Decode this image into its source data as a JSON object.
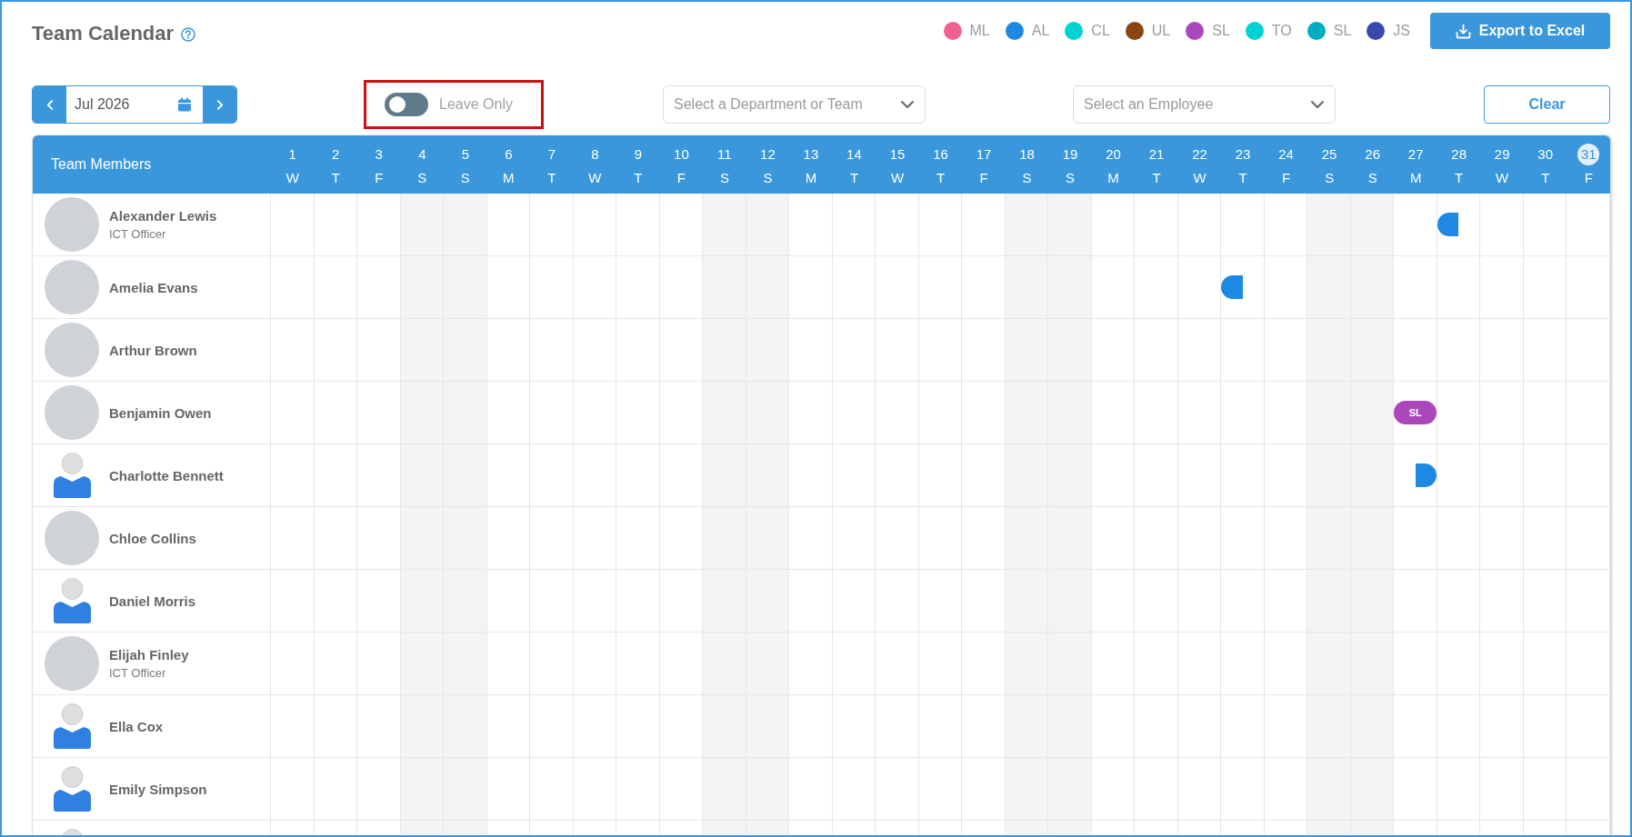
{
  "title": "Team Calendar",
  "legend": [
    {
      "label": "ML",
      "color": "#f06292"
    },
    {
      "label": "AL",
      "color": "#1e88e5"
    },
    {
      "label": "CL",
      "color": "#00d2d3"
    },
    {
      "label": "UL",
      "color": "#8b4513"
    },
    {
      "label": "SL",
      "color": "#ab47bc"
    },
    {
      "label": "TO",
      "color": "#00d2d3"
    },
    {
      "label": "SL",
      "color": "#00acc1"
    },
    {
      "label": "JS",
      "color": "#3949ab"
    }
  ],
  "export_button": {
    "label": "Export to Excel"
  },
  "month_picker": {
    "value": "Jul 2026"
  },
  "leave_toggle": {
    "label": "Leave Only",
    "on": false,
    "highlighted": true
  },
  "department_select": {
    "placeholder": "Select a Department or Team"
  },
  "employee_select": {
    "placeholder": "Select an Employee"
  },
  "clear_button": {
    "label": "Clear"
  },
  "calendar": {
    "member_column": "Team Members",
    "days": [
      {
        "day": "1",
        "weekday": "W",
        "weekend": false,
        "today": false
      },
      {
        "day": "2",
        "weekday": "T",
        "weekend": false,
        "today": false
      },
      {
        "day": "3",
        "weekday": "F",
        "weekend": false,
        "today": false
      },
      {
        "day": "4",
        "weekday": "S",
        "weekend": true,
        "today": false
      },
      {
        "day": "5",
        "weekday": "S",
        "weekend": true,
        "today": false
      },
      {
        "day": "6",
        "weekday": "M",
        "weekend": false,
        "today": false
      },
      {
        "day": "7",
        "weekday": "T",
        "weekend": false,
        "today": false
      },
      {
        "day": "8",
        "weekday": "W",
        "weekend": false,
        "today": false
      },
      {
        "day": "9",
        "weekday": "T",
        "weekend": false,
        "today": false
      },
      {
        "day": "10",
        "weekday": "F",
        "weekend": false,
        "today": false
      },
      {
        "day": "11",
        "weekday": "S",
        "weekend": true,
        "today": false
      },
      {
        "day": "12",
        "weekday": "S",
        "weekend": true,
        "today": false
      },
      {
        "day": "13",
        "weekday": "M",
        "weekend": false,
        "today": false
      },
      {
        "day": "14",
        "weekday": "T",
        "weekend": false,
        "today": false
      },
      {
        "day": "15",
        "weekday": "W",
        "weekend": false,
        "today": false
      },
      {
        "day": "16",
        "weekday": "T",
        "weekend": false,
        "today": false
      },
      {
        "day": "17",
        "weekday": "F",
        "weekend": false,
        "today": false
      },
      {
        "day": "18",
        "weekday": "S",
        "weekend": true,
        "today": false
      },
      {
        "day": "19",
        "weekday": "S",
        "weekend": true,
        "today": false
      },
      {
        "day": "20",
        "weekday": "M",
        "weekend": false,
        "today": false
      },
      {
        "day": "21",
        "weekday": "T",
        "weekend": false,
        "today": false
      },
      {
        "day": "22",
        "weekday": "W",
        "weekend": false,
        "today": false
      },
      {
        "day": "23",
        "weekday": "T",
        "weekend": false,
        "today": false
      },
      {
        "day": "24",
        "weekday": "F",
        "weekend": false,
        "today": false
      },
      {
        "day": "25",
        "weekday": "S",
        "weekend": true,
        "today": false
      },
      {
        "day": "26",
        "weekday": "S",
        "weekend": true,
        "today": false
      },
      {
        "day": "27",
        "weekday": "M",
        "weekend": false,
        "today": false
      },
      {
        "day": "28",
        "weekday": "T",
        "weekend": false,
        "today": false
      },
      {
        "day": "29",
        "weekday": "W",
        "weekend": false,
        "today": false
      },
      {
        "day": "30",
        "weekday": "T",
        "weekend": false,
        "today": false
      },
      {
        "day": "31",
        "weekday": "F",
        "weekend": false,
        "today": true
      }
    ],
    "members": [
      {
        "name": "Alexander Lewis",
        "role": "ICT Officer",
        "avatar": {
          "kind": "photo"
        },
        "day_cells": [
          null,
          null,
          null,
          null,
          null,
          null,
          null,
          null,
          null,
          null,
          null,
          null,
          null,
          null,
          null,
          null,
          null,
          null,
          null,
          null,
          null,
          null,
          null,
          null,
          null,
          null,
          null,
          {
            "kind": "first-half",
            "color": "#1e88e5"
          },
          null,
          null,
          null
        ]
      },
      {
        "name": "Amelia Evans",
        "avatar": {
          "kind": "photo"
        },
        "day_cells": [
          null,
          null,
          null,
          null,
          null,
          null,
          null,
          null,
          null,
          null,
          null,
          null,
          null,
          null,
          null,
          null,
          null,
          null,
          null,
          null,
          null,
          null,
          {
            "kind": "first-half",
            "color": "#1e88e5"
          },
          null,
          null,
          null,
          null,
          null,
          null,
          null,
          null
        ]
      },
      {
        "name": "Arthur Brown",
        "avatar": {
          "kind": "photo"
        }
      },
      {
        "name": "Benjamin Owen",
        "avatar": {
          "kind": "photo"
        },
        "day_cells": [
          null,
          null,
          null,
          null,
          null,
          null,
          null,
          null,
          null,
          null,
          null,
          null,
          null,
          null,
          null,
          null,
          null,
          null,
          null,
          null,
          null,
          null,
          null,
          null,
          null,
          null,
          {
            "kind": "full",
            "label": "SL",
            "color": "#ab47bc"
          },
          null,
          null,
          null,
          null
        ]
      },
      {
        "name": "Charlotte Bennett",
        "avatar": {
          "kind": "generic"
        },
        "day_cells": [
          null,
          null,
          null,
          null,
          null,
          null,
          null,
          null,
          null,
          null,
          null,
          null,
          null,
          null,
          null,
          null,
          null,
          null,
          null,
          null,
          null,
          null,
          null,
          null,
          null,
          null,
          {
            "kind": "second-half",
            "color": "#1e88e5"
          },
          null,
          null,
          null,
          null
        ]
      },
      {
        "name": "Chloe Collins",
        "avatar": {
          "kind": "photo"
        }
      },
      {
        "name": "Daniel Morris",
        "avatar": {
          "kind": "generic"
        }
      },
      {
        "name": "Elijah Finley",
        "role": "ICT Officer",
        "avatar": {
          "kind": "photo"
        }
      },
      {
        "name": "Ella Cox",
        "avatar": {
          "kind": "generic"
        }
      },
      {
        "name": "Emily Simpson",
        "avatar": {
          "kind": "generic"
        }
      },
      {
        "avatar": {
          "kind": "generic"
        }
      }
    ]
  }
}
